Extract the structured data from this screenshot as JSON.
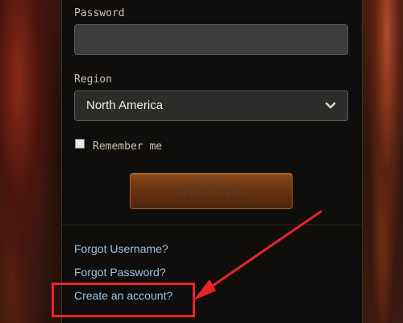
{
  "form": {
    "password_label": "Password",
    "password_value": "",
    "region_label": "Region",
    "region_value": "North America",
    "remember_label": "Remember me",
    "remember_checked": false,
    "signin_label": "SIGN IN"
  },
  "links": {
    "forgot_username": "Forgot Username?",
    "forgot_password": "Forgot Password?",
    "create_account": "Create an account?"
  },
  "colors": {
    "link": "#9fc3de",
    "annotation": "#e8232a",
    "signin_button": "#6a3412"
  }
}
